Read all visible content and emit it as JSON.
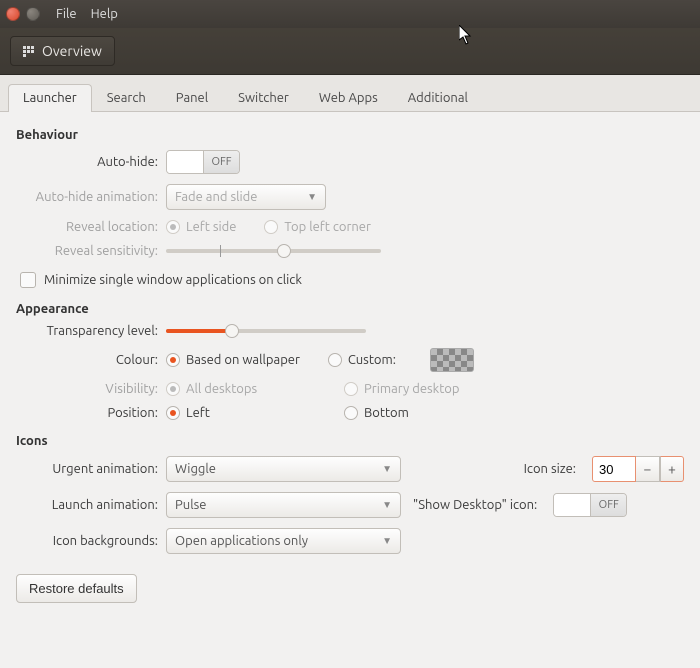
{
  "menubar": {
    "file": "File",
    "help": "Help"
  },
  "toolbar": {
    "overview": "Overview"
  },
  "tabs": [
    "Launcher",
    "Search",
    "Panel",
    "Switcher",
    "Web Apps",
    "Additional"
  ],
  "active_tab": 0,
  "sections": {
    "behaviour": {
      "heading": "Behaviour",
      "auto_hide_label": "Auto-hide:",
      "auto_hide_state": "OFF",
      "animation_label": "Auto-hide animation:",
      "animation_value": "Fade and slide",
      "reveal_location_label": "Reveal location:",
      "reveal_options": [
        "Left side",
        "Top left corner"
      ],
      "reveal_selected": 0,
      "reveal_sensitivity_label": "Reveal sensitivity:",
      "reveal_sensitivity_value": 55,
      "minimize_label": "Minimize single window applications on click",
      "minimize_checked": false
    },
    "appearance": {
      "heading": "Appearance",
      "transparency_label": "Transparency level:",
      "transparency_value": 33,
      "colour_label": "Colour:",
      "colour_options": [
        "Based on wallpaper",
        "Custom:"
      ],
      "colour_selected": 0,
      "visibility_label": "Visibility:",
      "visibility_options": [
        "All desktops",
        "Primary desktop"
      ],
      "visibility_selected": 0,
      "position_label": "Position:",
      "position_options": [
        "Left",
        "Bottom"
      ],
      "position_selected": 0
    },
    "icons": {
      "heading": "Icons",
      "urgent_label": "Urgent animation:",
      "urgent_value": "Wiggle",
      "launch_label": "Launch animation:",
      "launch_value": "Pulse",
      "backgrounds_label": "Icon backgrounds:",
      "backgrounds_value": "Open applications only",
      "icon_size_label": "Icon size:",
      "icon_size_value": "30",
      "show_desktop_label": "\"Show Desktop\" icon:",
      "show_desktop_state": "OFF"
    }
  },
  "restore_label": "Restore defaults",
  "colors": {
    "accent": "#e95420"
  }
}
